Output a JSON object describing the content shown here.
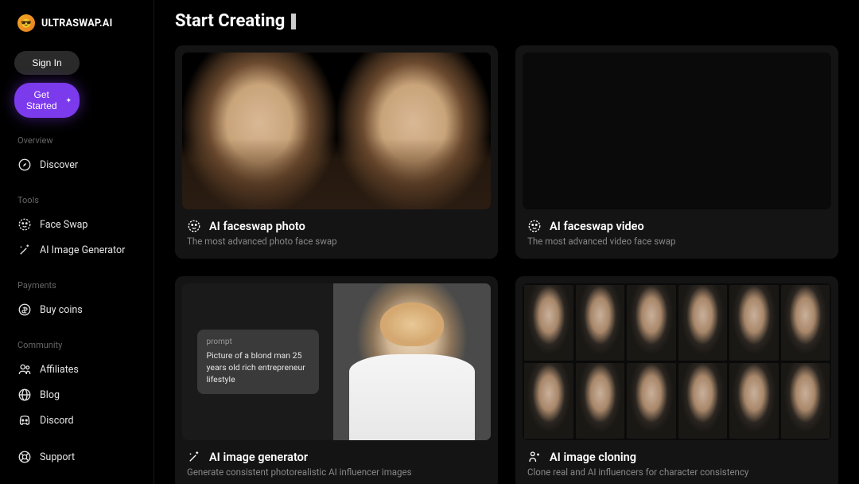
{
  "brand": "ULTRASWAP.AI",
  "buttons": {
    "signin": "Sign In",
    "getstarted": "Get Started"
  },
  "sections": {
    "overview": "Overview",
    "tools": "Tools",
    "payments": "Payments",
    "community": "Community"
  },
  "nav": {
    "discover": "Discover",
    "faceswap": "Face Swap",
    "aigen": "AI Image Generator",
    "buycoins": "Buy coins",
    "affiliates": "Affiliates",
    "blog": "Blog",
    "discord": "Discord",
    "support": "Support"
  },
  "page": {
    "title": "Start Creating"
  },
  "cards": [
    {
      "title": "AI faceswap photo",
      "desc": "The most advanced photo face swap"
    },
    {
      "title": "AI faceswap video",
      "desc": "The most advanced video face swap"
    },
    {
      "title": "AI image generator",
      "desc": "Generate consistent photorealistic AI influencer images"
    },
    {
      "title": "AI image cloning",
      "desc": "Clone real and AI influencers for character consistency"
    }
  ],
  "prompt": {
    "label": "prompt",
    "text": "Picture of a blond man 25 years old rich entrepreneur lifestyle"
  }
}
